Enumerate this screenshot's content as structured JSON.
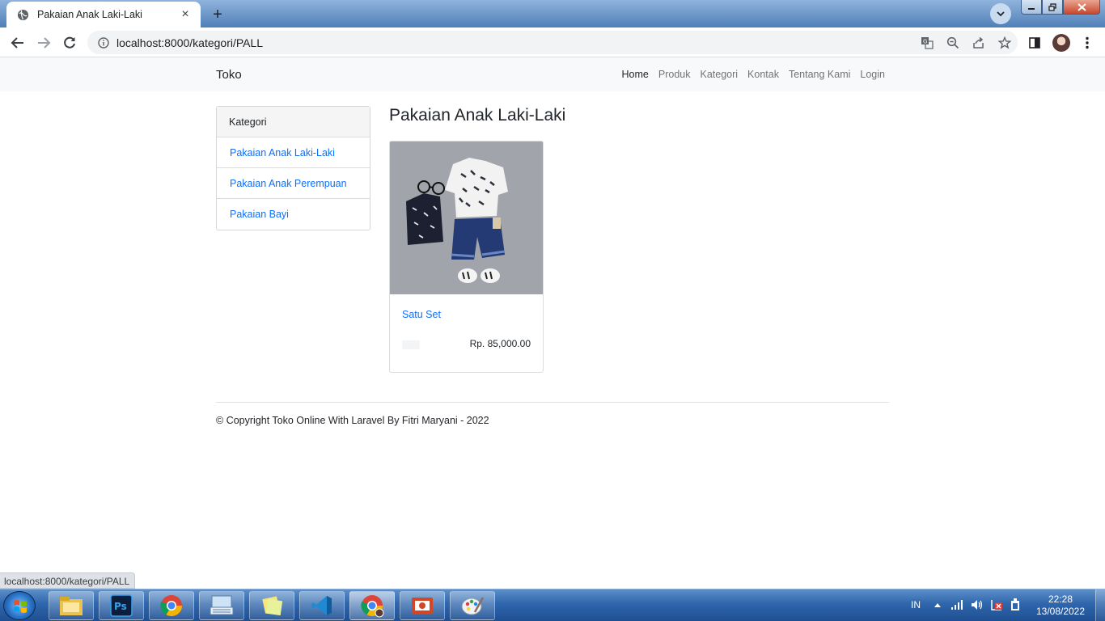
{
  "browser": {
    "tab_title": "Pakaian Anak Laki-Laki",
    "tab_close": "×",
    "new_tab": "+",
    "url": "localhost:8000/kategori/PALL",
    "status_url": "localhost:8000/kategori/PALL"
  },
  "navbar": {
    "brand": "Toko",
    "links": [
      {
        "label": "Home",
        "active": true
      },
      {
        "label": "Produk"
      },
      {
        "label": "Kategori"
      },
      {
        "label": "Kontak"
      },
      {
        "label": "Tentang Kami"
      },
      {
        "label": "Login"
      }
    ]
  },
  "sidebar": {
    "heading": "Kategori",
    "items": [
      {
        "label": "Pakaian Anak Laki-Laki"
      },
      {
        "label": "Pakaian Anak Perempuan"
      },
      {
        "label": "Pakaian Bayi"
      }
    ]
  },
  "main": {
    "title": "Pakaian Anak Laki-Laki",
    "products": [
      {
        "name": "Satu Set",
        "price": "Rp. 85,000.00"
      }
    ]
  },
  "footer": {
    "text": "© Copyright Toko Online With Laravel By Fitri Maryani - 2022"
  },
  "taskbar": {
    "language": "IN",
    "time": "22:28",
    "date": "13/08/2022",
    "apps": [
      "file-explorer",
      "photoshop",
      "chrome",
      "on-screen-keyboard",
      "sticky-notes",
      "vscode",
      "chrome-active",
      "presentation",
      "paint"
    ]
  },
  "colors": {
    "link": "#0d6efd",
    "navbar_bg": "#f8f9fa",
    "taskbar": "#2f66ac"
  }
}
